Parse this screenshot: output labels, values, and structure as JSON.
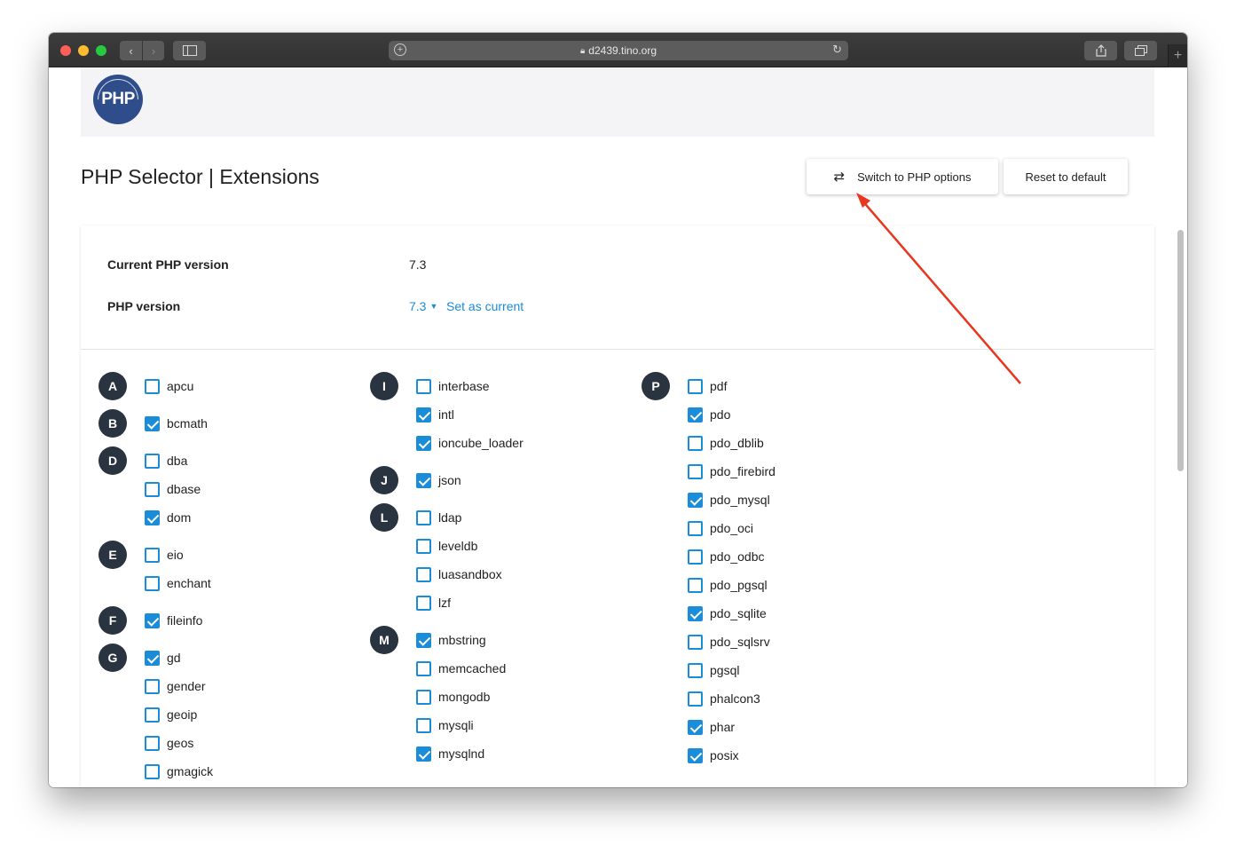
{
  "browser": {
    "url": "d2439.tino.org"
  },
  "page": {
    "title": "PHP Selector | Extensions",
    "logo_text": "PHP",
    "switch_button": "Switch to PHP options",
    "reset_button": "Reset to default"
  },
  "info": {
    "current_label": "Current PHP version",
    "current_value": "7.3",
    "version_label": "PHP version",
    "version_value": "7.3",
    "set_current": "Set as current"
  },
  "columns": [
    {
      "groups": [
        {
          "letter": "A",
          "items": [
            {
              "name": "apcu",
              "checked": false
            }
          ]
        },
        {
          "letter": "B",
          "items": [
            {
              "name": "bcmath",
              "checked": true
            }
          ]
        },
        {
          "letter": "D",
          "items": [
            {
              "name": "dba",
              "checked": false
            },
            {
              "name": "dbase",
              "checked": false
            },
            {
              "name": "dom",
              "checked": true
            }
          ]
        },
        {
          "letter": "E",
          "items": [
            {
              "name": "eio",
              "checked": false
            },
            {
              "name": "enchant",
              "checked": false
            }
          ]
        },
        {
          "letter": "F",
          "items": [
            {
              "name": "fileinfo",
              "checked": true
            }
          ]
        },
        {
          "letter": "G",
          "items": [
            {
              "name": "gd",
              "checked": true
            },
            {
              "name": "gender",
              "checked": false
            },
            {
              "name": "geoip",
              "checked": false
            },
            {
              "name": "geos",
              "checked": false
            },
            {
              "name": "gmagick",
              "checked": false
            }
          ]
        }
      ]
    },
    {
      "groups": [
        {
          "letter": "I",
          "items": [
            {
              "name": "interbase",
              "checked": false
            },
            {
              "name": "intl",
              "checked": true
            },
            {
              "name": "ioncube_loader",
              "checked": true
            }
          ]
        },
        {
          "letter": "J",
          "items": [
            {
              "name": "json",
              "checked": true
            }
          ]
        },
        {
          "letter": "L",
          "items": [
            {
              "name": "ldap",
              "checked": false
            },
            {
              "name": "leveldb",
              "checked": false
            },
            {
              "name": "luasandbox",
              "checked": false
            },
            {
              "name": "lzf",
              "checked": false
            }
          ]
        },
        {
          "letter": "M",
          "items": [
            {
              "name": "mbstring",
              "checked": true
            },
            {
              "name": "memcached",
              "checked": false
            },
            {
              "name": "mongodb",
              "checked": false
            },
            {
              "name": "mysqli",
              "checked": false
            },
            {
              "name": "mysqlnd",
              "checked": true
            }
          ]
        }
      ]
    },
    {
      "groups": [
        {
          "letter": "P",
          "items": [
            {
              "name": "pdf",
              "checked": false
            },
            {
              "name": "pdo",
              "checked": true
            },
            {
              "name": "pdo_dblib",
              "checked": false
            },
            {
              "name": "pdo_firebird",
              "checked": false
            },
            {
              "name": "pdo_mysql",
              "checked": true
            },
            {
              "name": "pdo_oci",
              "checked": false
            },
            {
              "name": "pdo_odbc",
              "checked": false
            },
            {
              "name": "pdo_pgsql",
              "checked": false
            },
            {
              "name": "pdo_sqlite",
              "checked": true
            },
            {
              "name": "pdo_sqlsrv",
              "checked": false
            },
            {
              "name": "pgsql",
              "checked": false
            },
            {
              "name": "phalcon3",
              "checked": false
            },
            {
              "name": "phar",
              "checked": true
            },
            {
              "name": "posix",
              "checked": true
            }
          ]
        }
      ]
    }
  ],
  "colors": {
    "accent": "#1a8cd8",
    "badge": "#2a3340",
    "annotation_arrow": "#e8361f"
  },
  "icons": {
    "back": "chevron-left-icon",
    "forward": "chevron-right-icon",
    "sidebar": "sidebar-icon",
    "share": "share-icon",
    "tabs": "tabs-icon",
    "reload": "reload-icon",
    "lock": "lock-icon",
    "switch": "switch-arrows-icon"
  }
}
